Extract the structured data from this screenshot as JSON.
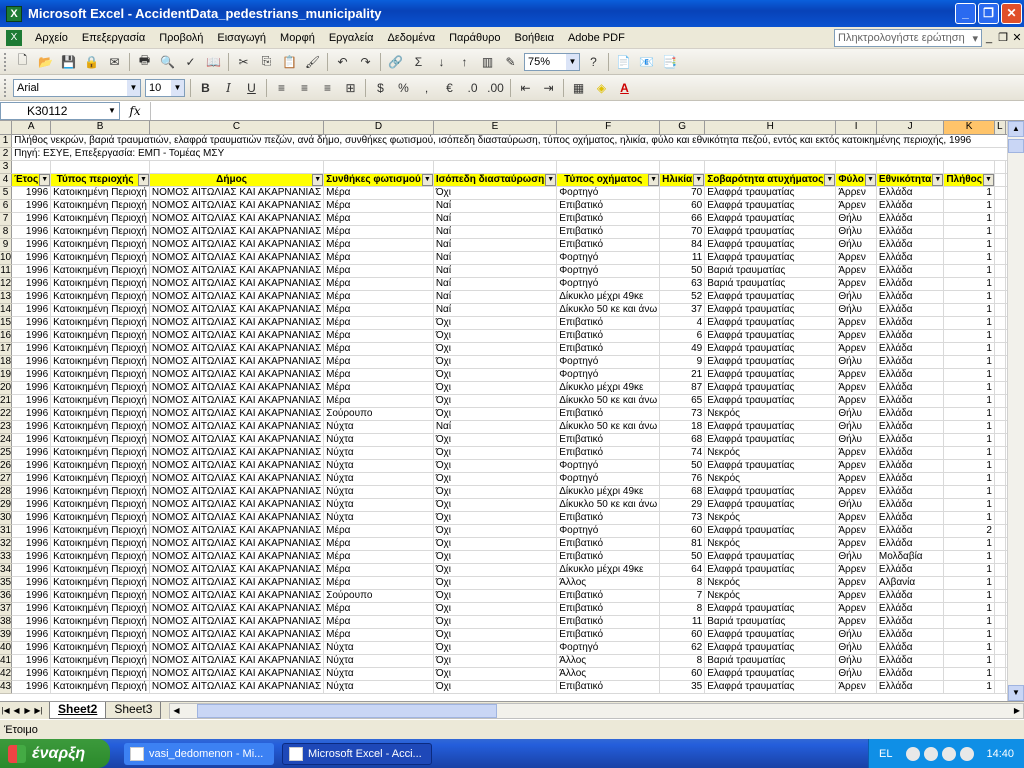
{
  "window": {
    "title": "Microsoft Excel - AccidentData_pedestrians_municipality"
  },
  "menu": {
    "items": [
      "Αρχείο",
      "Επεξεργασία",
      "Προβολή",
      "Εισαγωγή",
      "Μορφή",
      "Εργαλεία",
      "Δεδομένα",
      "Παράθυρο",
      "Βοήθεια",
      "Adobe PDF"
    ],
    "help_placeholder": "Πληκτρολογήστε ερώτηση"
  },
  "toolbar": {
    "zoom": "75%",
    "font": "Arial",
    "size": "10"
  },
  "formula_bar": {
    "name_box": "K30112",
    "fx": "fx",
    "content": ""
  },
  "columns": [
    "A",
    "B",
    "C",
    "D",
    "E",
    "F",
    "G",
    "H",
    "I",
    "J",
    "K",
    "L",
    "M"
  ],
  "selected_column": "K",
  "sheet": {
    "row1": "Πλήθος νεκρών, βαριά τραυματιών, ελαφρά τραυματιών πεζών, ανά δήμο, συνθήκες φωτισμού, ισόπεδη διασταύρωση, τύπος οχήματος, ηλικία, φύλο και εθνικότητα πεζού, εντός και εκτός κατοικημένης περιοχής, 1996",
    "row2": "Πηγή: ΕΣΥΕ, Επεξεργασία: ΕΜΠ - Τομέας ΜΣΥ",
    "headers": [
      "Έτος",
      "Τύπος περιοχής",
      "Δήμος",
      "Συνθήκες φωτισμού",
      "Ισόπεδη διασταύρωση",
      "Τύπος οχήματος",
      "Ηλικία",
      "Σοβαρότητα ατυχήματος",
      "Φύλο",
      "Εθνικότητα",
      "Πλήθος"
    ],
    "rows": [
      {
        "n": "5",
        "c": [
          "1996",
          "Κατοικημένη Περιοχή",
          "ΝΟΜΟΣ ΑΙΤΩΛΙΑΣ ΚΑΙ ΑΚΑΡΝΑΝΙΑΣ",
          "Μέρα",
          "Όχι",
          "Φορτηγό",
          "70",
          "Ελαφρά τραυματίας",
          "Άρρεν",
          "Ελλάδα",
          "1"
        ]
      },
      {
        "n": "6",
        "c": [
          "1996",
          "Κατοικημένη Περιοχή",
          "ΝΟΜΟΣ ΑΙΤΩΛΙΑΣ ΚΑΙ ΑΚΑΡΝΑΝΙΑΣ",
          "Μέρα",
          "Ναί",
          "Επιβατικό",
          "60",
          "Ελαφρά τραυματίας",
          "Άρρεν",
          "Ελλάδα",
          "1"
        ]
      },
      {
        "n": "7",
        "c": [
          "1996",
          "Κατοικημένη Περιοχή",
          "ΝΟΜΟΣ ΑΙΤΩΛΙΑΣ ΚΑΙ ΑΚΑΡΝΑΝΙΑΣ",
          "Μέρα",
          "Ναί",
          "Επιβατικό",
          "66",
          "Ελαφρά τραυματίας",
          "Θήλυ",
          "Ελλάδα",
          "1"
        ]
      },
      {
        "n": "8",
        "c": [
          "1996",
          "Κατοικημένη Περιοχή",
          "ΝΟΜΟΣ ΑΙΤΩΛΙΑΣ ΚΑΙ ΑΚΑΡΝΑΝΙΑΣ",
          "Μέρα",
          "Ναί",
          "Επιβατικό",
          "70",
          "Ελαφρά τραυματίας",
          "Θήλυ",
          "Ελλάδα",
          "1"
        ]
      },
      {
        "n": "9",
        "c": [
          "1996",
          "Κατοικημένη Περιοχή",
          "ΝΟΜΟΣ ΑΙΤΩΛΙΑΣ ΚΑΙ ΑΚΑΡΝΑΝΙΑΣ",
          "Μέρα",
          "Ναί",
          "Επιβατικό",
          "84",
          "Ελαφρά τραυματίας",
          "Θήλυ",
          "Ελλάδα",
          "1"
        ]
      },
      {
        "n": "10",
        "c": [
          "1996",
          "Κατοικημένη Περιοχή",
          "ΝΟΜΟΣ ΑΙΤΩΛΙΑΣ ΚΑΙ ΑΚΑΡΝΑΝΙΑΣ",
          "Μέρα",
          "Ναί",
          "Φορτηγό",
          "11",
          "Ελαφρά τραυματίας",
          "Άρρεν",
          "Ελλάδα",
          "1"
        ]
      },
      {
        "n": "11",
        "c": [
          "1996",
          "Κατοικημένη Περιοχή",
          "ΝΟΜΟΣ ΑΙΤΩΛΙΑΣ ΚΑΙ ΑΚΑΡΝΑΝΙΑΣ",
          "Μέρα",
          "Ναί",
          "Φορτηγό",
          "50",
          "Βαριά τραυματίας",
          "Άρρεν",
          "Ελλάδα",
          "1"
        ]
      },
      {
        "n": "12",
        "c": [
          "1996",
          "Κατοικημένη Περιοχή",
          "ΝΟΜΟΣ ΑΙΤΩΛΙΑΣ ΚΑΙ ΑΚΑΡΝΑΝΙΑΣ",
          "Μέρα",
          "Ναί",
          "Φορτηγό",
          "63",
          "Βαριά τραυματίας",
          "Άρρεν",
          "Ελλάδα",
          "1"
        ]
      },
      {
        "n": "13",
        "c": [
          "1996",
          "Κατοικημένη Περιοχή",
          "ΝΟΜΟΣ ΑΙΤΩΛΙΑΣ ΚΑΙ ΑΚΑΡΝΑΝΙΑΣ",
          "Μέρα",
          "Ναί",
          "Δίκυκλο μέχρι 49κε",
          "52",
          "Ελαφρά τραυματίας",
          "Θήλυ",
          "Ελλάδα",
          "1"
        ]
      },
      {
        "n": "14",
        "c": [
          "1996",
          "Κατοικημένη Περιοχή",
          "ΝΟΜΟΣ ΑΙΤΩΛΙΑΣ ΚΑΙ ΑΚΑΡΝΑΝΙΑΣ",
          "Μέρα",
          "Ναί",
          "Δίκυκλο 50 κε και άνω",
          "37",
          "Ελαφρά τραυματίας",
          "Θήλυ",
          "Ελλάδα",
          "1"
        ]
      },
      {
        "n": "15",
        "c": [
          "1996",
          "Κατοικημένη Περιοχή",
          "ΝΟΜΟΣ ΑΙΤΩΛΙΑΣ ΚΑΙ ΑΚΑΡΝΑΝΙΑΣ",
          "Μέρα",
          "Όχι",
          "Επιβατικό",
          "4",
          "Ελαφρά τραυματίας",
          "Άρρεν",
          "Ελλάδα",
          "1"
        ]
      },
      {
        "n": "16",
        "c": [
          "1996",
          "Κατοικημένη Περιοχή",
          "ΝΟΜΟΣ ΑΙΤΩΛΙΑΣ ΚΑΙ ΑΚΑΡΝΑΝΙΑΣ",
          "Μέρα",
          "Όχι",
          "Επιβατικό",
          "6",
          "Ελαφρά τραυματίας",
          "Άρρεν",
          "Ελλάδα",
          "1"
        ]
      },
      {
        "n": "17",
        "c": [
          "1996",
          "Κατοικημένη Περιοχή",
          "ΝΟΜΟΣ ΑΙΤΩΛΙΑΣ ΚΑΙ ΑΚΑΡΝΑΝΙΑΣ",
          "Μέρα",
          "Όχι",
          "Επιβατικό",
          "49",
          "Ελαφρά τραυματίας",
          "Άρρεν",
          "Ελλάδα",
          "1"
        ]
      },
      {
        "n": "18",
        "c": [
          "1996",
          "Κατοικημένη Περιοχή",
          "ΝΟΜΟΣ ΑΙΤΩΛΙΑΣ ΚΑΙ ΑΚΑΡΝΑΝΙΑΣ",
          "Μέρα",
          "Όχι",
          "Φορτηγό",
          "9",
          "Ελαφρά τραυματίας",
          "Θήλυ",
          "Ελλάδα",
          "1"
        ]
      },
      {
        "n": "19",
        "c": [
          "1996",
          "Κατοικημένη Περιοχή",
          "ΝΟΜΟΣ ΑΙΤΩΛΙΑΣ ΚΑΙ ΑΚΑΡΝΑΝΙΑΣ",
          "Μέρα",
          "Όχι",
          "Φορτηγό",
          "21",
          "Ελαφρά τραυματίας",
          "Άρρεν",
          "Ελλάδα",
          "1"
        ]
      },
      {
        "n": "20",
        "c": [
          "1996",
          "Κατοικημένη Περιοχή",
          "ΝΟΜΟΣ ΑΙΤΩΛΙΑΣ ΚΑΙ ΑΚΑΡΝΑΝΙΑΣ",
          "Μέρα",
          "Όχι",
          "Δίκυκλο μέχρι 49κε",
          "87",
          "Ελαφρά τραυματίας",
          "Άρρεν",
          "Ελλάδα",
          "1"
        ]
      },
      {
        "n": "21",
        "c": [
          "1996",
          "Κατοικημένη Περιοχή",
          "ΝΟΜΟΣ ΑΙΤΩΛΙΑΣ ΚΑΙ ΑΚΑΡΝΑΝΙΑΣ",
          "Μέρα",
          "Όχι",
          "Δίκυκλο 50 κε και άνω",
          "65",
          "Ελαφρά τραυματίας",
          "Άρρεν",
          "Ελλάδα",
          "1"
        ]
      },
      {
        "n": "22",
        "c": [
          "1996",
          "Κατοικημένη Περιοχή",
          "ΝΟΜΟΣ ΑΙΤΩΛΙΑΣ ΚΑΙ ΑΚΑΡΝΑΝΙΑΣ",
          "Σούρουπο",
          "Όχι",
          "Επιβατικό",
          "73",
          "Νεκρός",
          "Θήλυ",
          "Ελλάδα",
          "1"
        ]
      },
      {
        "n": "23",
        "c": [
          "1996",
          "Κατοικημένη Περιοχή",
          "ΝΟΜΟΣ ΑΙΤΩΛΙΑΣ ΚΑΙ ΑΚΑΡΝΑΝΙΑΣ",
          "Νύχτα",
          "Ναί",
          "Δίκυκλο 50 κε και άνω",
          "18",
          "Ελαφρά τραυματίας",
          "Θήλυ",
          "Ελλάδα",
          "1"
        ]
      },
      {
        "n": "24",
        "c": [
          "1996",
          "Κατοικημένη Περιοχή",
          "ΝΟΜΟΣ ΑΙΤΩΛΙΑΣ ΚΑΙ ΑΚΑΡΝΑΝΙΑΣ",
          "Νύχτα",
          "Όχι",
          "Επιβατικό",
          "68",
          "Ελαφρά τραυματίας",
          "Θήλυ",
          "Ελλάδα",
          "1"
        ]
      },
      {
        "n": "25",
        "c": [
          "1996",
          "Κατοικημένη Περιοχή",
          "ΝΟΜΟΣ ΑΙΤΩΛΙΑΣ ΚΑΙ ΑΚΑΡΝΑΝΙΑΣ",
          "Νύχτα",
          "Όχι",
          "Επιβατικό",
          "74",
          "Νεκρός",
          "Άρρεν",
          "Ελλάδα",
          "1"
        ]
      },
      {
        "n": "26",
        "c": [
          "1996",
          "Κατοικημένη Περιοχή",
          "ΝΟΜΟΣ ΑΙΤΩΛΙΑΣ ΚΑΙ ΑΚΑΡΝΑΝΙΑΣ",
          "Νύχτα",
          "Όχι",
          "Φορτηγό",
          "50",
          "Ελαφρά τραυματίας",
          "Άρρεν",
          "Ελλάδα",
          "1"
        ]
      },
      {
        "n": "27",
        "c": [
          "1996",
          "Κατοικημένη Περιοχή",
          "ΝΟΜΟΣ ΑΙΤΩΛΙΑΣ ΚΑΙ ΑΚΑΡΝΑΝΙΑΣ",
          "Νύχτα",
          "Όχι",
          "Φορτηγό",
          "76",
          "Νεκρός",
          "Άρρεν",
          "Ελλάδα",
          "1"
        ]
      },
      {
        "n": "28",
        "c": [
          "1996",
          "Κατοικημένη Περιοχή",
          "ΝΟΜΟΣ ΑΙΤΩΛΙΑΣ ΚΑΙ ΑΚΑΡΝΑΝΙΑΣ",
          "Νύχτα",
          "Όχι",
          "Δίκυκλο μέχρι 49κε",
          "68",
          "Ελαφρά τραυματίας",
          "Άρρεν",
          "Ελλάδα",
          "1"
        ]
      },
      {
        "n": "29",
        "c": [
          "1996",
          "Κατοικημένη Περιοχή",
          "ΝΟΜΟΣ ΑΙΤΩΛΙΑΣ ΚΑΙ ΑΚΑΡΝΑΝΙΑΣ",
          "Νύχτα",
          "Όχι",
          "Δίκυκλο 50 κε και άνω",
          "29",
          "Ελαφρά τραυματίας",
          "Θήλυ",
          "Ελλάδα",
          "1"
        ]
      },
      {
        "n": "30",
        "c": [
          "1996",
          "Κατοικημένη Περιοχή",
          "ΝΟΜΟΣ ΑΙΤΩΛΙΑΣ ΚΑΙ ΑΚΑΡΝΑΝΙΑΣ",
          "Νύχτα",
          "Όχι",
          "Επιβατικό",
          "73",
          "Νεκρός",
          "Άρρεν",
          "Ελλάδα",
          "1"
        ]
      },
      {
        "n": "31",
        "c": [
          "1996",
          "Κατοικημένη Περιοχή",
          "ΝΟΜΟΣ ΑΙΤΩΛΙΑΣ ΚΑΙ ΑΚΑΡΝΑΝΙΑΣ",
          "Μέρα",
          "Όχι",
          "Φορτηγό",
          "60",
          "Ελαφρά τραυματίας",
          "Άρρεν",
          "Ελλάδα",
          "2"
        ]
      },
      {
        "n": "32",
        "c": [
          "1996",
          "Κατοικημένη Περιοχή",
          "ΝΟΜΟΣ ΑΙΤΩΛΙΑΣ ΚΑΙ ΑΚΑΡΝΑΝΙΑΣ",
          "Μέρα",
          "Όχι",
          "Επιβατικό",
          "81",
          "Νεκρός",
          "Άρρεν",
          "Ελλάδα",
          "1"
        ]
      },
      {
        "n": "33",
        "c": [
          "1996",
          "Κατοικημένη Περιοχή",
          "ΝΟΜΟΣ ΑΙΤΩΛΙΑΣ ΚΑΙ ΑΚΑΡΝΑΝΙΑΣ",
          "Μέρα",
          "Όχι",
          "Επιβατικό",
          "50",
          "Ελαφρά τραυματίας",
          "Θήλυ",
          "Μολδαβία",
          "1"
        ]
      },
      {
        "n": "34",
        "c": [
          "1996",
          "Κατοικημένη Περιοχή",
          "ΝΟΜΟΣ ΑΙΤΩΛΙΑΣ ΚΑΙ ΑΚΑΡΝΑΝΙΑΣ",
          "Μέρα",
          "Όχι",
          "Δίκυκλο μέχρι 49κε",
          "64",
          "Ελαφρά τραυματίας",
          "Άρρεν",
          "Ελλάδα",
          "1"
        ]
      },
      {
        "n": "35",
        "c": [
          "1996",
          "Κατοικημένη Περιοχή",
          "ΝΟΜΟΣ ΑΙΤΩΛΙΑΣ ΚΑΙ ΑΚΑΡΝΑΝΙΑΣ",
          "Μέρα",
          "Όχι",
          "Άλλος",
          "8",
          "Νεκρός",
          "Άρρεν",
          "Αλβανία",
          "1"
        ]
      },
      {
        "n": "36",
        "c": [
          "1996",
          "Κατοικημένη Περιοχή",
          "ΝΟΜΟΣ ΑΙΤΩΛΙΑΣ ΚΑΙ ΑΚΑΡΝΑΝΙΑΣ",
          "Σούρουπο",
          "Όχι",
          "Επιβατικό",
          "7",
          "Νεκρός",
          "Άρρεν",
          "Ελλάδα",
          "1"
        ]
      },
      {
        "n": "37",
        "c": [
          "1996",
          "Κατοικημένη Περιοχή",
          "ΝΟΜΟΣ ΑΙΤΩΛΙΑΣ ΚΑΙ ΑΚΑΡΝΑΝΙΑΣ",
          "Μέρα",
          "Όχι",
          "Επιβατικό",
          "8",
          "Ελαφρά τραυματίας",
          "Άρρεν",
          "Ελλάδα",
          "1"
        ]
      },
      {
        "n": "38",
        "c": [
          "1996",
          "Κατοικημένη Περιοχή",
          "ΝΟΜΟΣ ΑΙΤΩΛΙΑΣ ΚΑΙ ΑΚΑΡΝΑΝΙΑΣ",
          "Μέρα",
          "Όχι",
          "Επιβατικό",
          "11",
          "Βαριά τραυματίας",
          "Άρρεν",
          "Ελλάδα",
          "1"
        ]
      },
      {
        "n": "39",
        "c": [
          "1996",
          "Κατοικημένη Περιοχή",
          "ΝΟΜΟΣ ΑΙΤΩΛΙΑΣ ΚΑΙ ΑΚΑΡΝΑΝΙΑΣ",
          "Μέρα",
          "Όχι",
          "Επιβατικό",
          "60",
          "Ελαφρά τραυματίας",
          "Θήλυ",
          "Ελλάδα",
          "1"
        ]
      },
      {
        "n": "40",
        "c": [
          "1996",
          "Κατοικημένη Περιοχή",
          "ΝΟΜΟΣ ΑΙΤΩΛΙΑΣ ΚΑΙ ΑΚΑΡΝΑΝΙΑΣ",
          "Νύχτα",
          "Όχι",
          "Φορτηγό",
          "62",
          "Ελαφρά τραυματίας",
          "Θήλυ",
          "Ελλάδα",
          "1"
        ]
      },
      {
        "n": "41",
        "c": [
          "1996",
          "Κατοικημένη Περιοχή",
          "ΝΟΜΟΣ ΑΙΤΩΛΙΑΣ ΚΑΙ ΑΚΑΡΝΑΝΙΑΣ",
          "Νύχτα",
          "Όχι",
          "Άλλος",
          "8",
          "Βαριά τραυματίας",
          "Θήλυ",
          "Ελλάδα",
          "1"
        ]
      },
      {
        "n": "42",
        "c": [
          "1996",
          "Κατοικημένη Περιοχή",
          "ΝΟΜΟΣ ΑΙΤΩΛΙΑΣ ΚΑΙ ΑΚΑΡΝΑΝΙΑΣ",
          "Νύχτα",
          "Όχι",
          "Άλλος",
          "60",
          "Ελαφρά τραυματίας",
          "Θήλυ",
          "Ελλάδα",
          "1"
        ]
      },
      {
        "n": "43",
        "c": [
          "1996",
          "Κατοικημένη Περιοχή",
          "ΝΟΜΟΣ ΑΙΤΩΛΙΑΣ ΚΑΙ ΑΚΑΡΝΑΝΙΑΣ",
          "Νύχτα",
          "Όχι",
          "Επιβατικό",
          "35",
          "Ελαφρά τραυματίας",
          "Άρρεν",
          "Ελλάδα",
          "1"
        ]
      }
    ]
  },
  "tabs": [
    "Sheet2",
    "Sheet3"
  ],
  "active_tab": "Sheet2",
  "status": {
    "text": "Έτοιμο"
  },
  "taskbar": {
    "start": "έναρξη",
    "tasks": [
      "vasi_dedomenon - Mi...",
      "Microsoft Excel - Acci..."
    ],
    "lang": "EL",
    "clock": "14:40"
  }
}
